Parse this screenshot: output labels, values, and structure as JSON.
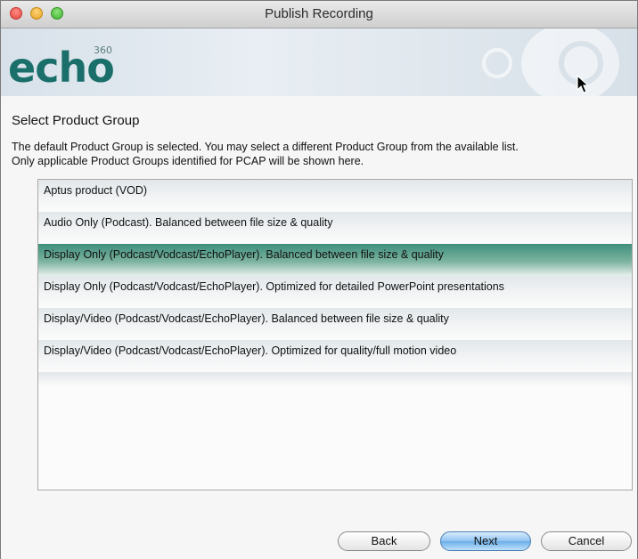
{
  "window": {
    "title": "Publish Recording"
  },
  "banner": {
    "logo_text": "echo",
    "logo_superscript": "360"
  },
  "content": {
    "section_title": "Select Product Group",
    "description_line1": "The default Product Group is selected.  You may select a different Product Group from the available list.",
    "description_line2": "Only applicable Product Groups identified for PCAP will be shown here."
  },
  "product_groups": {
    "items": [
      {
        "label": "Aptus product (VOD)"
      },
      {
        "label": "Audio Only (Podcast). Balanced between file size & quality"
      },
      {
        "label": "Display Only (Podcast/Vodcast/EchoPlayer). Balanced between file size & quality"
      },
      {
        "label": "Display Only (Podcast/Vodcast/EchoPlayer). Optimized for detailed PowerPoint presentations"
      },
      {
        "label": "Display/Video (Podcast/Vodcast/EchoPlayer). Balanced between file size & quality"
      },
      {
        "label": "Display/Video (Podcast/Vodcast/EchoPlayer). Optimized for quality/full motion video"
      }
    ],
    "selected_index": 2
  },
  "buttons": {
    "back": "Back",
    "next": "Next",
    "cancel": "Cancel"
  },
  "colors": {
    "selection": "#3f8f7c",
    "brand": "#1b6f6a",
    "default_button": "#6aaee8"
  }
}
